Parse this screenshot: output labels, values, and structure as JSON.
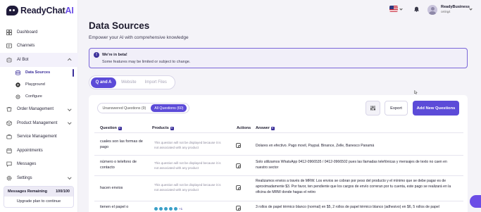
{
  "brand": {
    "name_main": "ReadyChat",
    "name_ai": "AI"
  },
  "sidebar": {
    "items": [
      {
        "label": "Dashboard",
        "icon": "dashboard-icon"
      },
      {
        "label": "Channels",
        "icon": "channels-icon"
      },
      {
        "label": "AI Bot",
        "icon": "bot-icon",
        "expanded": true
      },
      {
        "label": "Order Management",
        "icon": "order-icon"
      },
      {
        "label": "Product Management",
        "icon": "product-icon"
      },
      {
        "label": "Service Management",
        "icon": "service-icon"
      },
      {
        "label": "Appointments",
        "icon": "calendar-icon"
      },
      {
        "label": "Messages",
        "icon": "messages-icon"
      },
      {
        "label": "Settings",
        "icon": "settings-icon"
      }
    ],
    "ai_bot_sub": [
      {
        "label": "Data Sources",
        "icon": "database-icon",
        "active": true
      },
      {
        "label": "Playground",
        "icon": "play-icon"
      },
      {
        "label": "Configure",
        "icon": "configure-icon"
      }
    ],
    "messages_remaining": {
      "label": "Messages Remaining",
      "value": "100/100",
      "upgrade": "Upgrade plan to continue"
    }
  },
  "header": {
    "user_name": "ReadyBusiness",
    "user_sub": "ceting4"
  },
  "page": {
    "title": "Data Sources",
    "subtitle": "Empower your AI with comprehensive knowledge"
  },
  "beta": {
    "title": "We're in beta!",
    "message": "Some features may be limited or subject to change."
  },
  "source_tabs": [
    "Q and A",
    "Website",
    "Import Files"
  ],
  "question_tabs": [
    "Unanswered Questions (9)",
    "All Questions (60)"
  ],
  "buttons": {
    "export": "Export",
    "add": "Add New Questions"
  },
  "table": {
    "headers": {
      "question": "Question",
      "products": "Products",
      "actions": "Actions",
      "answer": "Answer"
    },
    "rows": [
      {
        "question": "cuales son las formas de pago",
        "products": "This question will not be displayed because it is not associated with any product",
        "answer": "Dolares en efectivo. Pago movil, Paypal. Binance, Zelle, Banesco Panamá"
      },
      {
        "question": "número o telefono de contacto",
        "products": "This question will not be displayed because it is not associated with any product",
        "answer": "Solo utilizamos WhatsApp 0412-0966535 / 0412-0966502 pues las llamadas telefónicas y mensajes de texto no caen en nuestro sector"
      },
      {
        "question": "hacen envios",
        "products": "This question will not be displayed because it is not associated with any product",
        "answer": "Realizamos envios a través de MRW. Los envios se cobran por peso del producto y el mínimo que se debe pagar es de aproximadamente $3. Por favor, ten pendiente que los cargos de envío correran por tu cuenta, este pago se realizará en la oficina de MRW donde hagas el retiro"
      },
      {
        "question": "tienen el papel o",
        "products_more": "+1",
        "answer": "3 rollos de papel térmico blanco (normal) en $5, 2 rollos de papel térmico blanco (adhesivo) en $6, 5 rollos de papel"
      }
    ]
  }
}
